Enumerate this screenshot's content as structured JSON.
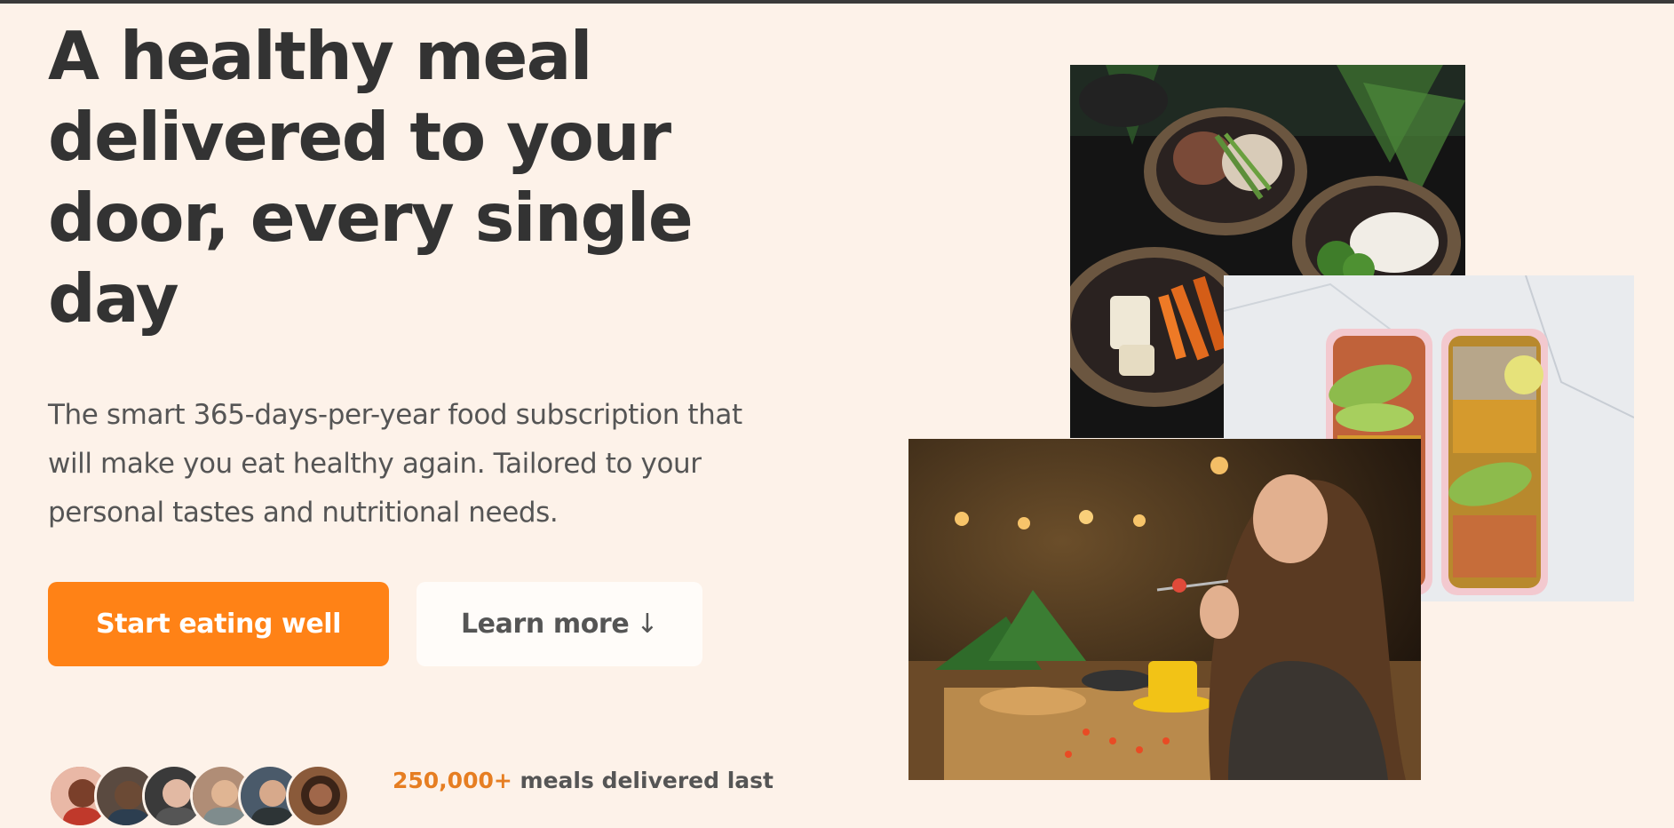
{
  "hero": {
    "headline": "A healthy meal delivered to your door, every single day",
    "description": "The smart 365-days-per-year food subscription that will make you eat healthy again. Tailored to your personal tastes and nutritional needs.",
    "cta_primary": "Start eating well",
    "cta_secondary": "Learn more",
    "cta_secondary_arrow": "↓"
  },
  "delivered": {
    "count": "250,000+",
    "text": "meals delivered last"
  },
  "colors": {
    "background": "#fdf2e9",
    "primary": "#ff8216",
    "accent": "#e67e22",
    "heading": "#333333",
    "body_text": "#555555"
  },
  "images": {
    "bowls": "food-bowls-photo",
    "boxes": "meal-prep-boxes-photo",
    "woman": "woman-eating-photo"
  }
}
